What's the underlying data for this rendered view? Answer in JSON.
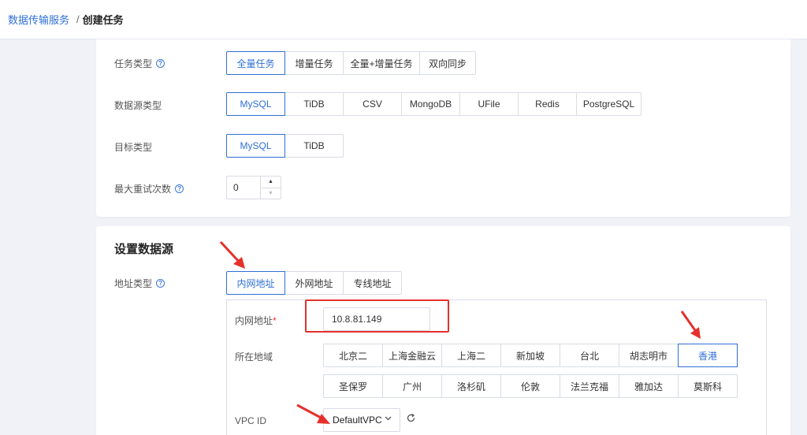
{
  "breadcrumb": {
    "parent": "数据传输服务",
    "separator": "/",
    "current": "创建任务"
  },
  "task_type": {
    "label": "任务类型",
    "options": [
      "全量任务",
      "增量任务",
      "全量+增量任务",
      "双向同步"
    ],
    "selected": "全量任务"
  },
  "source_type": {
    "label": "数据源类型",
    "options": [
      "MySQL",
      "TiDB",
      "CSV",
      "MongoDB",
      "UFile",
      "Redis",
      "PostgreSQL"
    ],
    "selected": "MySQL"
  },
  "target_type": {
    "label": "目标类型",
    "options": [
      "MySQL",
      "TiDB"
    ],
    "selected": "MySQL"
  },
  "max_retry": {
    "label": "最大重试次数",
    "value": "0"
  },
  "data_source": {
    "title": "设置数据源",
    "address_type": {
      "label": "地址类型",
      "options": [
        "内网地址",
        "外网地址",
        "专线地址"
      ],
      "selected": "内网地址"
    },
    "intranet_address": {
      "label": "内网地址",
      "required_mark": "*",
      "value": "10.8.81.149"
    },
    "region": {
      "label": "所在地域",
      "row1": [
        "北京二",
        "上海金融云",
        "上海二",
        "新加坡",
        "台北",
        "胡志明市",
        "香港"
      ],
      "row2": [
        "圣保罗",
        "广州",
        "洛杉矶",
        "伦敦",
        "法兰克福",
        "雅加达",
        "莫斯科"
      ],
      "selected": "香港"
    },
    "vpc": {
      "label": "VPC ID",
      "value": "DefaultVPC"
    }
  },
  "icons": {
    "help": "question-circle-icon",
    "chevron": "chevron-down-icon",
    "refresh": "refresh-icon",
    "annotation": "red-arrow-icon"
  },
  "colors": {
    "accent": "#2f6fd6",
    "annotation": "#e5302c",
    "background": "#f0f2f7"
  }
}
